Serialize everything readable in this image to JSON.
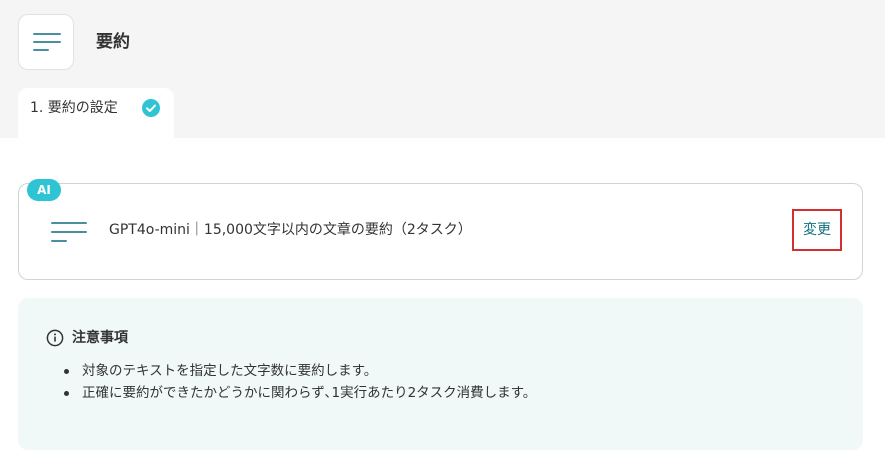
{
  "header": {
    "title": "要約",
    "menu_icon": "menu-lines-icon"
  },
  "tabs": [
    {
      "label": "1. 要約の設定",
      "status_icon": "check-circle-icon",
      "status": "completed"
    }
  ],
  "ai_setting": {
    "badge": "AI",
    "icon": "summary-lines-icon",
    "text": "GPT4o-mini｜15,000文字以内の文章の要約（2タスク）",
    "change_label": "変更"
  },
  "notice": {
    "icon": "info-icon",
    "title": "注意事項",
    "items": [
      "対象のテキストを指定した文字数に要約します。",
      "正確に要約ができたかどうかに関わらず､1実行あたり2タスク消費します。"
    ]
  },
  "colors": {
    "accent": "#2ec4d4",
    "icon_lines": "#4a8fa0",
    "link_text": "#0e7180",
    "highlight_border": "#d32f2f",
    "notice_bg": "#f1f9f8",
    "top_bg": "#f5f5f5"
  }
}
